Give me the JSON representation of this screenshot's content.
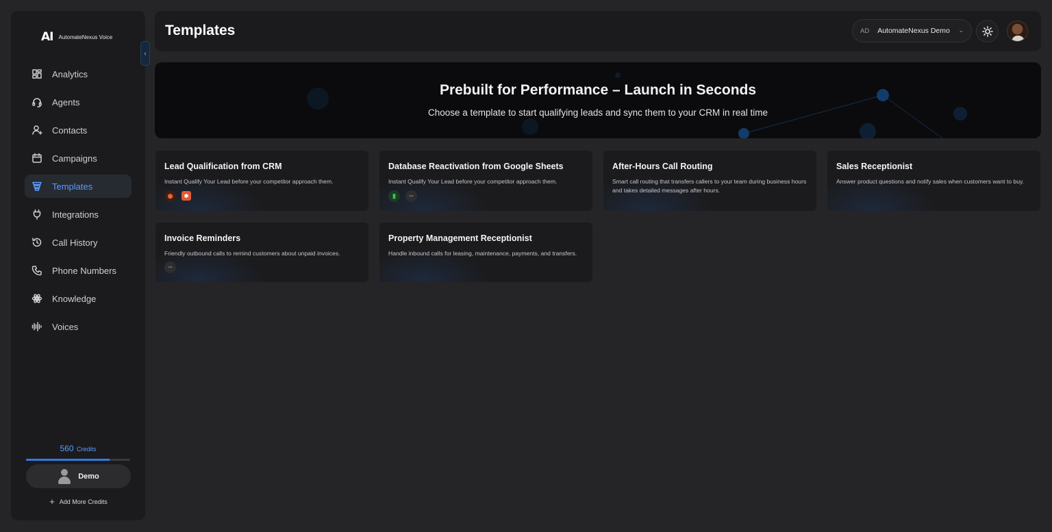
{
  "brand": {
    "mark": "AI",
    "name": "AutomateNexus Voice"
  },
  "sidebar": {
    "items": [
      {
        "label": "Analytics",
        "icon": "grid-icon"
      },
      {
        "label": "Agents",
        "icon": "headset-icon"
      },
      {
        "label": "Contacts",
        "icon": "user-icon"
      },
      {
        "label": "Campaigns",
        "icon": "calendar-icon"
      },
      {
        "label": "Templates",
        "icon": "templates-icon",
        "active": true
      },
      {
        "label": "Integrations",
        "icon": "plug-icon"
      },
      {
        "label": "Call History",
        "icon": "history-icon"
      },
      {
        "label": "Phone Numbers",
        "icon": "phone-icon"
      },
      {
        "label": "Knowledge",
        "icon": "atom-icon"
      },
      {
        "label": "Voices",
        "icon": "waveform-icon"
      }
    ],
    "credits_value": "560",
    "credits_unit": "Credits",
    "credits_progress": 0.8,
    "user_name": "Demo",
    "add_credits_label": "Add More Credits"
  },
  "header": {
    "title": "Templates",
    "org_initials": "AD",
    "org_name": "AutomateNexus Demo"
  },
  "hero": {
    "title": "Prebuilt for Performance – Launch in Seconds",
    "subtitle": "Choose a template to start qualifying leads and sync them to your CRM in real time"
  },
  "templates": [
    {
      "title": "Lead Qualification from CRM",
      "description": "Instant Qualify Your Lead before your competitor approach them.",
      "icons": [
        "crm-icon",
        "hubspot-icon"
      ]
    },
    {
      "title": "Database Reactivation from Google Sheets",
      "description": "Instant Qualify Your Lead before your competitor approach them.",
      "icons": [
        "google-sheets-icon",
        "integration-logo-icon"
      ]
    },
    {
      "title": "After-Hours Call Routing",
      "description": "Smart call routing that transfers callers to your team during business hours and takes detailed messages after hours.",
      "icons": []
    },
    {
      "title": "Sales Receptionist",
      "description": "Answer product questions and notify sales when customers want to buy.",
      "icons": []
    },
    {
      "title": "Invoice Reminders",
      "description": "Friendly outbound calls to remind customers about unpaid invoices.",
      "icons": [
        "integration-logo-icon"
      ]
    },
    {
      "title": "Property Management Receptionist",
      "description": "Handle inbound calls for leasing, maintenance, payments, and transfers.",
      "icons": []
    }
  ],
  "colors": {
    "accent": "#5a9cff",
    "background": "#252527",
    "panel": "#1b1b1d"
  }
}
